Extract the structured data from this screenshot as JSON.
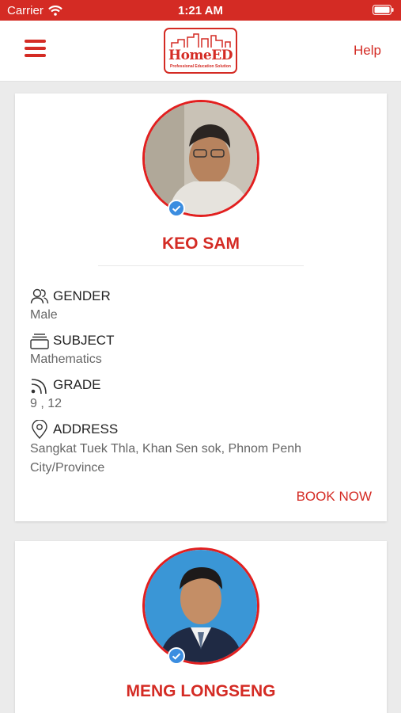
{
  "status_bar": {
    "carrier": "Carrier",
    "time": "1:21 AM"
  },
  "nav": {
    "logo_text": "HomeED",
    "logo_tagline": "Professional Education Solution",
    "help_label": "Help"
  },
  "tutors": [
    {
      "name": "KEO SAM",
      "gender_label": "GENDER",
      "gender": "Male",
      "subject_label": "SUBJECT",
      "subject": "Mathematics",
      "grade_label": "GRADE",
      "grade": "9 , 12",
      "address_label": "ADDRESS",
      "address": "Sangkat Tuek Thla, Khan Sen sok, Phnom Penh City/Province",
      "book_label": "BOOK NOW"
    },
    {
      "name": "MENG LONGSENG"
    }
  ],
  "colors": {
    "accent": "#d42b24",
    "verified": "#3b8de0"
  }
}
